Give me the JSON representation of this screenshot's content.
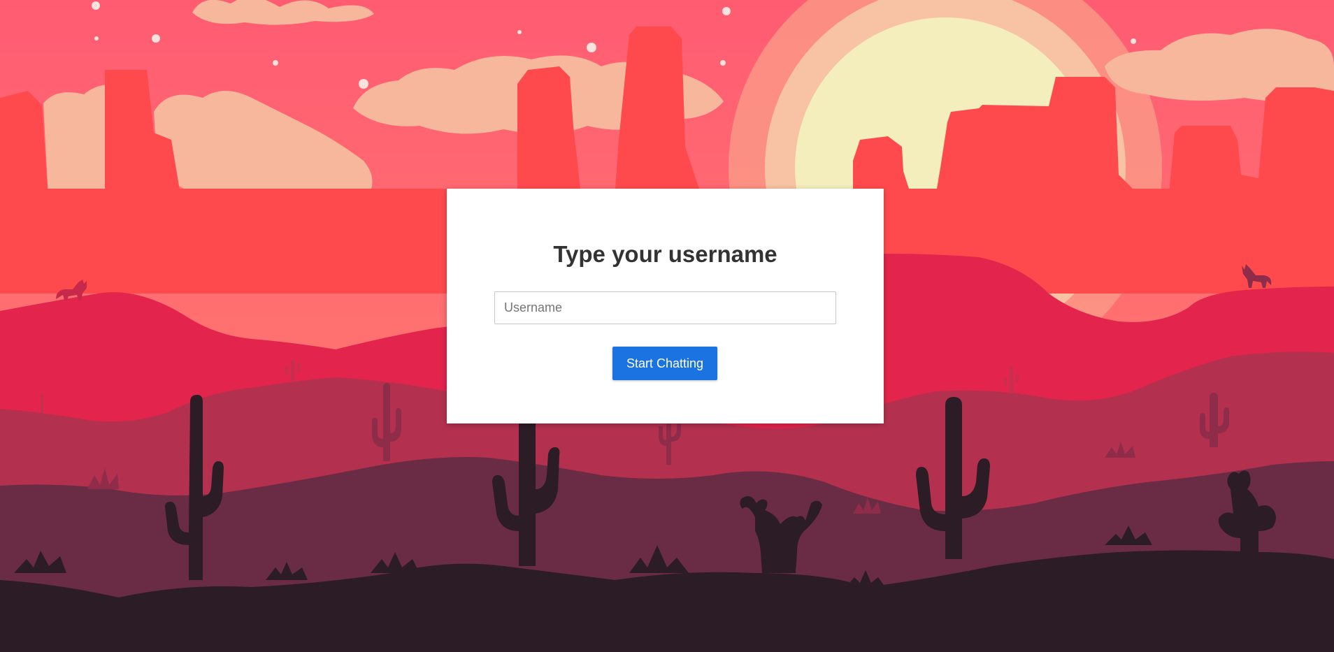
{
  "login": {
    "title": "Type your username",
    "username_placeholder": "Username",
    "username_value": "",
    "submit_label": "Start Chatting"
  },
  "colors": {
    "sky": "#ff5f6d",
    "sun": "#f4eebd",
    "clouds": "#f7b79c",
    "mesas": "#ff4a4d",
    "hills_far": "#e3244c",
    "hills_mid": "#b3314f",
    "hills_near": "#6a2b44",
    "ground": "#2b1c26",
    "button": "#1a73e0"
  },
  "icons": [
    "wolf-icon",
    "cactus-icon",
    "agave-icon"
  ]
}
